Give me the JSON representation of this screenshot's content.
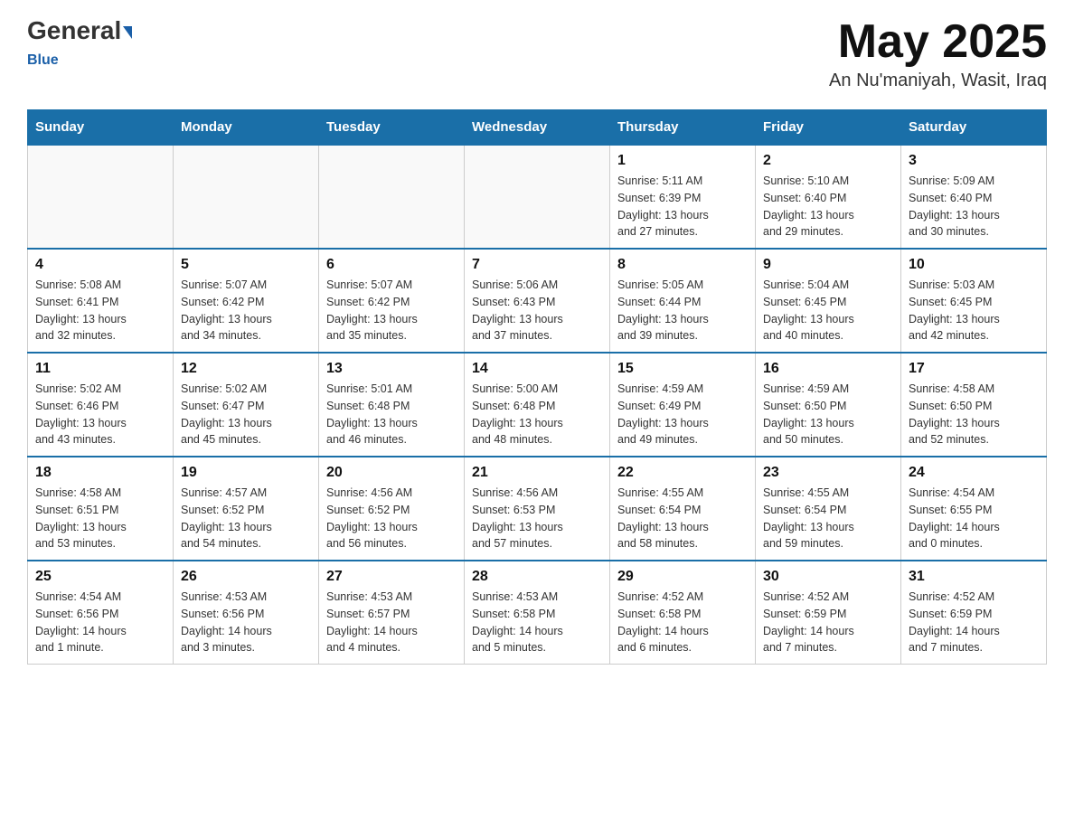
{
  "header": {
    "logo_general": "General",
    "logo_blue": "Blue",
    "month_year": "May 2025",
    "location": "An Nu'maniyah, Wasit, Iraq"
  },
  "weekdays": [
    "Sunday",
    "Monday",
    "Tuesday",
    "Wednesday",
    "Thursday",
    "Friday",
    "Saturday"
  ],
  "weeks": [
    [
      {
        "day": "",
        "info": ""
      },
      {
        "day": "",
        "info": ""
      },
      {
        "day": "",
        "info": ""
      },
      {
        "day": "",
        "info": ""
      },
      {
        "day": "1",
        "info": "Sunrise: 5:11 AM\nSunset: 6:39 PM\nDaylight: 13 hours\nand 27 minutes."
      },
      {
        "day": "2",
        "info": "Sunrise: 5:10 AM\nSunset: 6:40 PM\nDaylight: 13 hours\nand 29 minutes."
      },
      {
        "day": "3",
        "info": "Sunrise: 5:09 AM\nSunset: 6:40 PM\nDaylight: 13 hours\nand 30 minutes."
      }
    ],
    [
      {
        "day": "4",
        "info": "Sunrise: 5:08 AM\nSunset: 6:41 PM\nDaylight: 13 hours\nand 32 minutes."
      },
      {
        "day": "5",
        "info": "Sunrise: 5:07 AM\nSunset: 6:42 PM\nDaylight: 13 hours\nand 34 minutes."
      },
      {
        "day": "6",
        "info": "Sunrise: 5:07 AM\nSunset: 6:42 PM\nDaylight: 13 hours\nand 35 minutes."
      },
      {
        "day": "7",
        "info": "Sunrise: 5:06 AM\nSunset: 6:43 PM\nDaylight: 13 hours\nand 37 minutes."
      },
      {
        "day": "8",
        "info": "Sunrise: 5:05 AM\nSunset: 6:44 PM\nDaylight: 13 hours\nand 39 minutes."
      },
      {
        "day": "9",
        "info": "Sunrise: 5:04 AM\nSunset: 6:45 PM\nDaylight: 13 hours\nand 40 minutes."
      },
      {
        "day": "10",
        "info": "Sunrise: 5:03 AM\nSunset: 6:45 PM\nDaylight: 13 hours\nand 42 minutes."
      }
    ],
    [
      {
        "day": "11",
        "info": "Sunrise: 5:02 AM\nSunset: 6:46 PM\nDaylight: 13 hours\nand 43 minutes."
      },
      {
        "day": "12",
        "info": "Sunrise: 5:02 AM\nSunset: 6:47 PM\nDaylight: 13 hours\nand 45 minutes."
      },
      {
        "day": "13",
        "info": "Sunrise: 5:01 AM\nSunset: 6:48 PM\nDaylight: 13 hours\nand 46 minutes."
      },
      {
        "day": "14",
        "info": "Sunrise: 5:00 AM\nSunset: 6:48 PM\nDaylight: 13 hours\nand 48 minutes."
      },
      {
        "day": "15",
        "info": "Sunrise: 4:59 AM\nSunset: 6:49 PM\nDaylight: 13 hours\nand 49 minutes."
      },
      {
        "day": "16",
        "info": "Sunrise: 4:59 AM\nSunset: 6:50 PM\nDaylight: 13 hours\nand 50 minutes."
      },
      {
        "day": "17",
        "info": "Sunrise: 4:58 AM\nSunset: 6:50 PM\nDaylight: 13 hours\nand 52 minutes."
      }
    ],
    [
      {
        "day": "18",
        "info": "Sunrise: 4:58 AM\nSunset: 6:51 PM\nDaylight: 13 hours\nand 53 minutes."
      },
      {
        "day": "19",
        "info": "Sunrise: 4:57 AM\nSunset: 6:52 PM\nDaylight: 13 hours\nand 54 minutes."
      },
      {
        "day": "20",
        "info": "Sunrise: 4:56 AM\nSunset: 6:52 PM\nDaylight: 13 hours\nand 56 minutes."
      },
      {
        "day": "21",
        "info": "Sunrise: 4:56 AM\nSunset: 6:53 PM\nDaylight: 13 hours\nand 57 minutes."
      },
      {
        "day": "22",
        "info": "Sunrise: 4:55 AM\nSunset: 6:54 PM\nDaylight: 13 hours\nand 58 minutes."
      },
      {
        "day": "23",
        "info": "Sunrise: 4:55 AM\nSunset: 6:54 PM\nDaylight: 13 hours\nand 59 minutes."
      },
      {
        "day": "24",
        "info": "Sunrise: 4:54 AM\nSunset: 6:55 PM\nDaylight: 14 hours\nand 0 minutes."
      }
    ],
    [
      {
        "day": "25",
        "info": "Sunrise: 4:54 AM\nSunset: 6:56 PM\nDaylight: 14 hours\nand 1 minute."
      },
      {
        "day": "26",
        "info": "Sunrise: 4:53 AM\nSunset: 6:56 PM\nDaylight: 14 hours\nand 3 minutes."
      },
      {
        "day": "27",
        "info": "Sunrise: 4:53 AM\nSunset: 6:57 PM\nDaylight: 14 hours\nand 4 minutes."
      },
      {
        "day": "28",
        "info": "Sunrise: 4:53 AM\nSunset: 6:58 PM\nDaylight: 14 hours\nand 5 minutes."
      },
      {
        "day": "29",
        "info": "Sunrise: 4:52 AM\nSunset: 6:58 PM\nDaylight: 14 hours\nand 6 minutes."
      },
      {
        "day": "30",
        "info": "Sunrise: 4:52 AM\nSunset: 6:59 PM\nDaylight: 14 hours\nand 7 minutes."
      },
      {
        "day": "31",
        "info": "Sunrise: 4:52 AM\nSunset: 6:59 PM\nDaylight: 14 hours\nand 7 minutes."
      }
    ]
  ]
}
